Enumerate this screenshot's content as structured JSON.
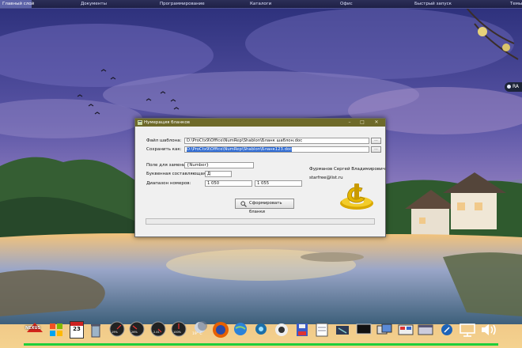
{
  "top_menu": [
    {
      "label": "Главный слой"
    },
    {
      "label": "Документы"
    },
    {
      "label": "Программирование"
    },
    {
      "label": "Каталоги"
    },
    {
      "label": "Офис"
    },
    {
      "label": "Быстрый запуск"
    },
    {
      "label": "Темы"
    }
  ],
  "side_badge": {
    "label": "RA"
  },
  "dialog": {
    "title": "Нумерация бланков",
    "template_label": "Файл шаблона:",
    "template_value": "D:\\ProCtx9\\Office\\NumRep\\Shablon\\Бланк шаблон.doc",
    "save_label": "Сохранить как:",
    "save_value": "D:\\ProCtx9\\Office\\NumRep\\Shablon\\Бланк123.doc",
    "browse_label": "...",
    "replace_label": "Поле для замены:",
    "replace_value": "{Number}",
    "letter_label": "Буквенная составляющая:",
    "letter_value": "Д",
    "range_label": "Диапазон номеров:",
    "range_from": "1 050",
    "range_to": "1 055",
    "author_name": "Фурманов Сергей Владимирович",
    "author_email": "starfree@list.ru",
    "make_button": "Сформировать бланки"
  },
  "taskbar": {
    "calendar_day": "23",
    "temperature": "19° C",
    "widget_values": [
      "19%",
      "26%",
      "2.41",
      "100%",
      "3.00"
    ],
    "brand": "NEXUS"
  },
  "colors": {
    "titlebar": "#6e6a2a",
    "selection": "#2f6bd3",
    "topbar": "#2c2f57",
    "taskbar_line": "#1fcf3a"
  }
}
